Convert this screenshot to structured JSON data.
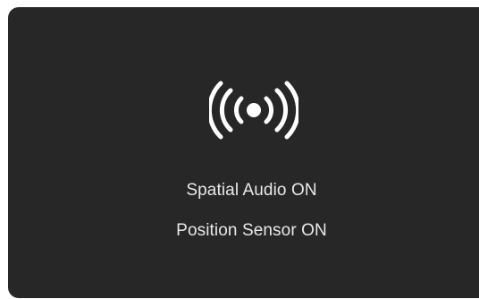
{
  "hud": {
    "icon": "broadcast-icon",
    "spatial_audio_status": "Spatial Audio ON",
    "position_sensor_status": "Position Sensor ON"
  },
  "colors": {
    "panel_background": "#272727",
    "text": "#e8e8e8",
    "icon": "#ffffff",
    "page_background": "#ffffff"
  }
}
